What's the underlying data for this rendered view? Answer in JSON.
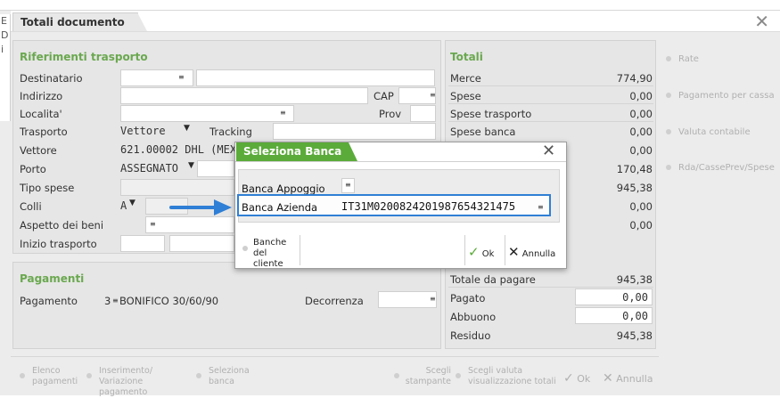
{
  "window": {
    "title": "Totali documento",
    "left_letters": [
      "E",
      "D",
      "i",
      "",
      "",
      "",
      "N"
    ]
  },
  "riferimenti": {
    "title": "Riferimenti trasporto",
    "destinatario_label": "Destinatario",
    "indirizzo_label": "Indirizzo",
    "cap_label": "CAP",
    "localita_label": "Localita'",
    "prov_label": "Prov",
    "trasporto_label": "Trasporto",
    "trasporto_value": "Vettore",
    "tracking_label": "Tracking",
    "vettore_label": "Vettore",
    "vettore_value": "621.00002 DHL (MEX",
    "porto_label": "Porto",
    "porto_value": "ASSEGNATO",
    "tipo_spese_label": "Tipo spese",
    "colli_label": "Colli",
    "colli_value": "A",
    "aspetto_label": "Aspetto dei beni",
    "inizio_label": "Inizio trasporto"
  },
  "pagamenti": {
    "title": "Pagamenti",
    "pagamento_label": "Pagamento",
    "pagamento_code": "3",
    "pagamento_value": "BONIFICO 30/60/90",
    "decorrenza_label": "Decorrenza"
  },
  "totali": {
    "title": "Totali",
    "rows": [
      {
        "label": "Merce",
        "value": "774,90"
      },
      {
        "label": "Spese",
        "value": "0,00"
      },
      {
        "label": "Spese trasporto",
        "value": "0,00"
      },
      {
        "label": "Spese banca",
        "value": "0,00"
      },
      {
        "label": "",
        "value": "0,00"
      },
      {
        "label": "",
        "value": "170,48"
      },
      {
        "label": "",
        "value": "945,38"
      },
      {
        "label": "",
        "value": "0,00"
      },
      {
        "label": "",
        "value": "0,00"
      }
    ],
    "totale_da_pagare_label": "Totale da pagare",
    "totale_da_pagare_value": "945,38",
    "pagato_label": "Pagato",
    "pagato_value": "0,00",
    "abbuono_label": "Abbuono",
    "abbuono_value": "0,00",
    "residuo_label": "Residuo",
    "residuo_value": "945,38"
  },
  "side_buttons": [
    "Rate",
    "Pagamento per cassa",
    "Valuta contabile",
    "Rda/CassePrev/Spese"
  ],
  "bottom_buttons": {
    "elenco": [
      "Elenco",
      "pagamenti"
    ],
    "inserimento": [
      "Inserimento/",
      "Variazione pagamento"
    ],
    "seleziona": [
      "Seleziona",
      "banca"
    ],
    "scegli_stampante": [
      "Scegli",
      "stampante"
    ],
    "scegli_valuta": [
      "Scegli valuta",
      "visualizzazione totali"
    ],
    "ok": "Ok",
    "annulla": "Annulla"
  },
  "modal": {
    "title": "Seleziona Banca",
    "banca_appoggio_label": "Banca Appoggio",
    "banca_azienda_label": "Banca Azienda",
    "banca_azienda_value": "IT31M0200824201987654321475",
    "banche_cliente": [
      "Banche",
      "del cliente"
    ],
    "ok": "Ok",
    "annulla": "Annulla"
  },
  "colors": {
    "accent_green": "#5bab3a",
    "section_green": "#6aa84f",
    "highlight_blue": "#2f7fd6"
  }
}
